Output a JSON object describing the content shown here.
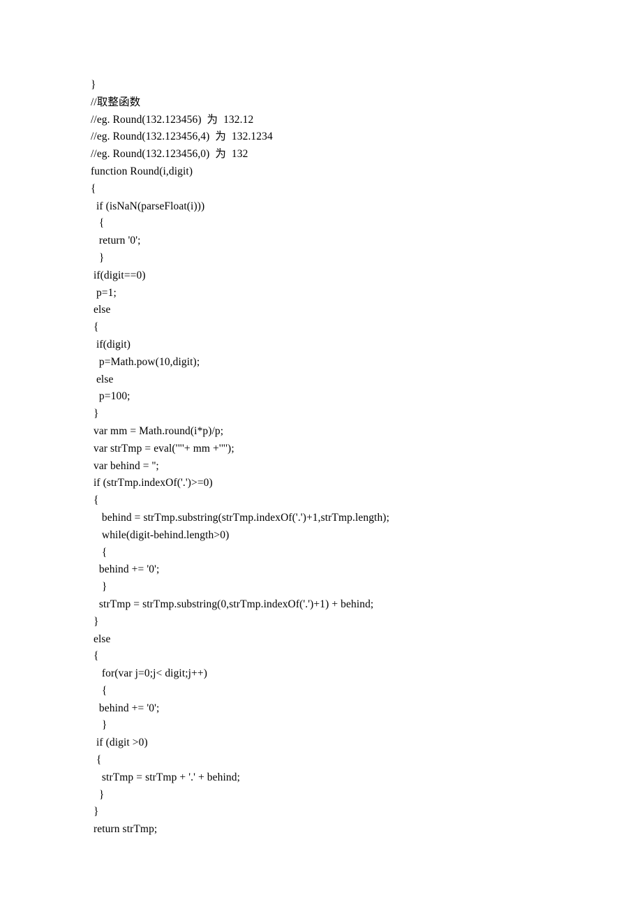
{
  "code": {
    "lines": [
      "}",
      "//取整函数",
      "//eg. Round(132.123456)  为  132.12",
      "//eg. Round(132.123456,4)  为  132.1234",
      "//eg. Round(132.123456,0)  为  132",
      "function Round(i,digit)",
      "{",
      "  if (isNaN(parseFloat(i)))",
      "   {",
      "   return '0';",
      "   }",
      " if(digit==0)",
      "  p=1;",
      " else",
      " {",
      "  if(digit)",
      "   p=Math.pow(10,digit);",
      "  else",
      "   p=100;",
      " }",
      " var mm = Math.round(i*p)/p;",
      " var strTmp = eval('\"'+ mm +'\"');",
      " var behind = '';",
      " if (strTmp.indexOf('.')>=0)",
      " {",
      "    behind = strTmp.substring(strTmp.indexOf('.')+1,strTmp.length);",
      "    while(digit-behind.length>0)",
      "    {",
      "   behind += '0';",
      "    }",
      "   strTmp = strTmp.substring(0,strTmp.indexOf('.')+1) + behind;",
      " }",
      " else",
      " {",
      "    for(var j=0;j< digit;j++)",
      "    {",
      "   behind += '0';",
      "    }",
      "  if (digit >0)",
      "  {",
      "    strTmp = strTmp + '.' + behind;",
      "   }",
      " }",
      " return strTmp;"
    ]
  }
}
